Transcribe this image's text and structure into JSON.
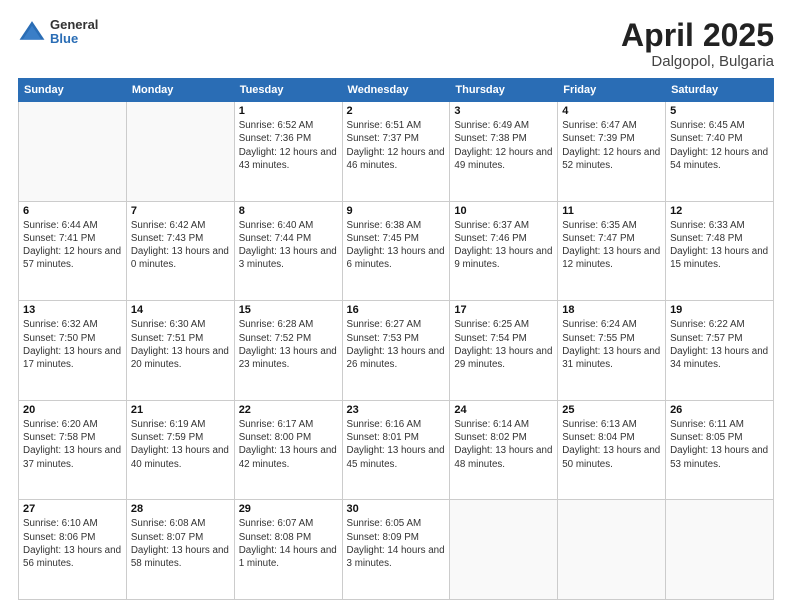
{
  "header": {
    "logo_general": "General",
    "logo_blue": "Blue",
    "title": "April 2025",
    "location": "Dalgopol, Bulgaria"
  },
  "weekdays": [
    "Sunday",
    "Monday",
    "Tuesday",
    "Wednesday",
    "Thursday",
    "Friday",
    "Saturday"
  ],
  "weeks": [
    [
      {
        "day": "",
        "info": ""
      },
      {
        "day": "",
        "info": ""
      },
      {
        "day": "1",
        "info": "Sunrise: 6:52 AM\nSunset: 7:36 PM\nDaylight: 12 hours and 43 minutes."
      },
      {
        "day": "2",
        "info": "Sunrise: 6:51 AM\nSunset: 7:37 PM\nDaylight: 12 hours and 46 minutes."
      },
      {
        "day": "3",
        "info": "Sunrise: 6:49 AM\nSunset: 7:38 PM\nDaylight: 12 hours and 49 minutes."
      },
      {
        "day": "4",
        "info": "Sunrise: 6:47 AM\nSunset: 7:39 PM\nDaylight: 12 hours and 52 minutes."
      },
      {
        "day": "5",
        "info": "Sunrise: 6:45 AM\nSunset: 7:40 PM\nDaylight: 12 hours and 54 minutes."
      }
    ],
    [
      {
        "day": "6",
        "info": "Sunrise: 6:44 AM\nSunset: 7:41 PM\nDaylight: 12 hours and 57 minutes."
      },
      {
        "day": "7",
        "info": "Sunrise: 6:42 AM\nSunset: 7:43 PM\nDaylight: 13 hours and 0 minutes."
      },
      {
        "day": "8",
        "info": "Sunrise: 6:40 AM\nSunset: 7:44 PM\nDaylight: 13 hours and 3 minutes."
      },
      {
        "day": "9",
        "info": "Sunrise: 6:38 AM\nSunset: 7:45 PM\nDaylight: 13 hours and 6 minutes."
      },
      {
        "day": "10",
        "info": "Sunrise: 6:37 AM\nSunset: 7:46 PM\nDaylight: 13 hours and 9 minutes."
      },
      {
        "day": "11",
        "info": "Sunrise: 6:35 AM\nSunset: 7:47 PM\nDaylight: 13 hours and 12 minutes."
      },
      {
        "day": "12",
        "info": "Sunrise: 6:33 AM\nSunset: 7:48 PM\nDaylight: 13 hours and 15 minutes."
      }
    ],
    [
      {
        "day": "13",
        "info": "Sunrise: 6:32 AM\nSunset: 7:50 PM\nDaylight: 13 hours and 17 minutes."
      },
      {
        "day": "14",
        "info": "Sunrise: 6:30 AM\nSunset: 7:51 PM\nDaylight: 13 hours and 20 minutes."
      },
      {
        "day": "15",
        "info": "Sunrise: 6:28 AM\nSunset: 7:52 PM\nDaylight: 13 hours and 23 minutes."
      },
      {
        "day": "16",
        "info": "Sunrise: 6:27 AM\nSunset: 7:53 PM\nDaylight: 13 hours and 26 minutes."
      },
      {
        "day": "17",
        "info": "Sunrise: 6:25 AM\nSunset: 7:54 PM\nDaylight: 13 hours and 29 minutes."
      },
      {
        "day": "18",
        "info": "Sunrise: 6:24 AM\nSunset: 7:55 PM\nDaylight: 13 hours and 31 minutes."
      },
      {
        "day": "19",
        "info": "Sunrise: 6:22 AM\nSunset: 7:57 PM\nDaylight: 13 hours and 34 minutes."
      }
    ],
    [
      {
        "day": "20",
        "info": "Sunrise: 6:20 AM\nSunset: 7:58 PM\nDaylight: 13 hours and 37 minutes."
      },
      {
        "day": "21",
        "info": "Sunrise: 6:19 AM\nSunset: 7:59 PM\nDaylight: 13 hours and 40 minutes."
      },
      {
        "day": "22",
        "info": "Sunrise: 6:17 AM\nSunset: 8:00 PM\nDaylight: 13 hours and 42 minutes."
      },
      {
        "day": "23",
        "info": "Sunrise: 6:16 AM\nSunset: 8:01 PM\nDaylight: 13 hours and 45 minutes."
      },
      {
        "day": "24",
        "info": "Sunrise: 6:14 AM\nSunset: 8:02 PM\nDaylight: 13 hours and 48 minutes."
      },
      {
        "day": "25",
        "info": "Sunrise: 6:13 AM\nSunset: 8:04 PM\nDaylight: 13 hours and 50 minutes."
      },
      {
        "day": "26",
        "info": "Sunrise: 6:11 AM\nSunset: 8:05 PM\nDaylight: 13 hours and 53 minutes."
      }
    ],
    [
      {
        "day": "27",
        "info": "Sunrise: 6:10 AM\nSunset: 8:06 PM\nDaylight: 13 hours and 56 minutes."
      },
      {
        "day": "28",
        "info": "Sunrise: 6:08 AM\nSunset: 8:07 PM\nDaylight: 13 hours and 58 minutes."
      },
      {
        "day": "29",
        "info": "Sunrise: 6:07 AM\nSunset: 8:08 PM\nDaylight: 14 hours and 1 minute."
      },
      {
        "day": "30",
        "info": "Sunrise: 6:05 AM\nSunset: 8:09 PM\nDaylight: 14 hours and 3 minutes."
      },
      {
        "day": "",
        "info": ""
      },
      {
        "day": "",
        "info": ""
      },
      {
        "day": "",
        "info": ""
      }
    ]
  ]
}
